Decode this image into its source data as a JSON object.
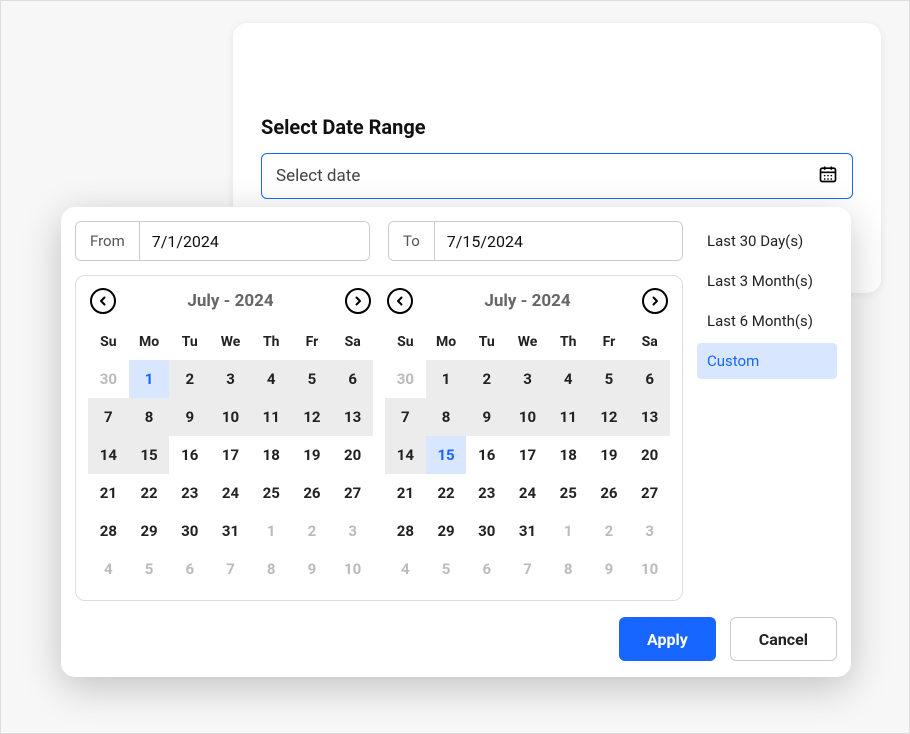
{
  "card": {
    "title": "Select Date Range",
    "placeholder": "Select date"
  },
  "popover": {
    "from_label": "From",
    "from_value": "7/1/2024",
    "to_label": "To",
    "to_value": "7/15/2024",
    "apply": "Apply",
    "cancel": "Cancel"
  },
  "dow": [
    "Su",
    "Mo",
    "Tu",
    "We",
    "Th",
    "Fr",
    "Sa"
  ],
  "months": [
    {
      "title": "July - 2024",
      "selected": 1,
      "range_end": 15,
      "cells": [
        {
          "n": 30,
          "o": true
        },
        {
          "n": 1
        },
        {
          "n": 2
        },
        {
          "n": 3
        },
        {
          "n": 4
        },
        {
          "n": 5
        },
        {
          "n": 6
        },
        {
          "n": 7
        },
        {
          "n": 8
        },
        {
          "n": 9
        },
        {
          "n": 10
        },
        {
          "n": 11
        },
        {
          "n": 12
        },
        {
          "n": 13
        },
        {
          "n": 14
        },
        {
          "n": 15
        },
        {
          "n": 16
        },
        {
          "n": 17
        },
        {
          "n": 18
        },
        {
          "n": 19
        },
        {
          "n": 20
        },
        {
          "n": 21
        },
        {
          "n": 22
        },
        {
          "n": 23
        },
        {
          "n": 24
        },
        {
          "n": 25
        },
        {
          "n": 26
        },
        {
          "n": 27
        },
        {
          "n": 28
        },
        {
          "n": 29
        },
        {
          "n": 30
        },
        {
          "n": 31
        },
        {
          "n": 1,
          "o": true
        },
        {
          "n": 2,
          "o": true
        },
        {
          "n": 3,
          "o": true
        },
        {
          "n": 4,
          "o": true
        },
        {
          "n": 5,
          "o": true
        },
        {
          "n": 6,
          "o": true
        },
        {
          "n": 7,
          "o": true
        },
        {
          "n": 8,
          "o": true
        },
        {
          "n": 9,
          "o": true
        },
        {
          "n": 10,
          "o": true
        }
      ]
    },
    {
      "title": "July - 2024",
      "selected": 15,
      "range_end": 15,
      "cells": [
        {
          "n": 30,
          "o": true
        },
        {
          "n": 1
        },
        {
          "n": 2
        },
        {
          "n": 3
        },
        {
          "n": 4
        },
        {
          "n": 5
        },
        {
          "n": 6
        },
        {
          "n": 7
        },
        {
          "n": 8
        },
        {
          "n": 9
        },
        {
          "n": 10
        },
        {
          "n": 11
        },
        {
          "n": 12
        },
        {
          "n": 13
        },
        {
          "n": 14
        },
        {
          "n": 15
        },
        {
          "n": 16
        },
        {
          "n": 17
        },
        {
          "n": 18
        },
        {
          "n": 19
        },
        {
          "n": 20
        },
        {
          "n": 21
        },
        {
          "n": 22
        },
        {
          "n": 23
        },
        {
          "n": 24
        },
        {
          "n": 25
        },
        {
          "n": 26
        },
        {
          "n": 27
        },
        {
          "n": 28
        },
        {
          "n": 29
        },
        {
          "n": 30
        },
        {
          "n": 31
        },
        {
          "n": 1,
          "o": true
        },
        {
          "n": 2,
          "o": true
        },
        {
          "n": 3,
          "o": true
        },
        {
          "n": 4,
          "o": true
        },
        {
          "n": 5,
          "o": true
        },
        {
          "n": 6,
          "o": true
        },
        {
          "n": 7,
          "o": true
        },
        {
          "n": 8,
          "o": true
        },
        {
          "n": 9,
          "o": true
        },
        {
          "n": 10,
          "o": true
        }
      ]
    }
  ],
  "presets": [
    {
      "label": "Last 30 Day(s)",
      "active": false
    },
    {
      "label": "Last 3 Month(s)",
      "active": false
    },
    {
      "label": "Last 6 Month(s)",
      "active": false
    },
    {
      "label": "Custom",
      "active": true
    }
  ]
}
